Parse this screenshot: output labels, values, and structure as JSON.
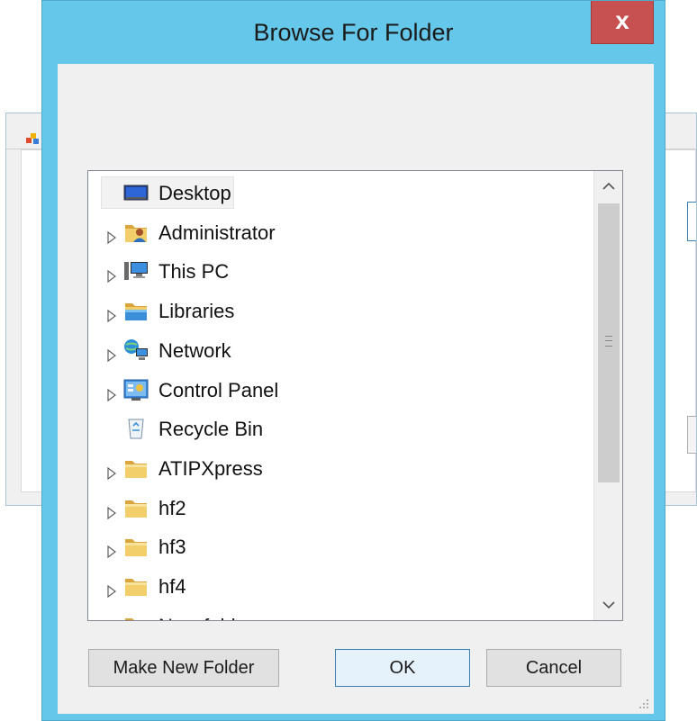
{
  "dialog": {
    "title": "Browse For Folder",
    "close_symbol": "x"
  },
  "tree": {
    "items": [
      {
        "label": "Desktop",
        "icon": "desktop-icon",
        "has_expander": false,
        "selected": true
      },
      {
        "label": "Administrator",
        "icon": "user-folder-icon",
        "has_expander": true
      },
      {
        "label": "This PC",
        "icon": "computer-icon",
        "has_expander": true
      },
      {
        "label": "Libraries",
        "icon": "libraries-icon",
        "has_expander": true
      },
      {
        "label": "Network",
        "icon": "network-icon",
        "has_expander": true
      },
      {
        "label": "Control Panel",
        "icon": "control-panel-icon",
        "has_expander": true
      },
      {
        "label": "Recycle Bin",
        "icon": "recycle-bin-icon",
        "has_expander": false
      },
      {
        "label": "ATIPXpress",
        "icon": "folder-icon",
        "has_expander": true
      },
      {
        "label": "hf2",
        "icon": "folder-icon",
        "has_expander": true
      },
      {
        "label": "hf3",
        "icon": "folder-icon",
        "has_expander": true
      },
      {
        "label": "hf4",
        "icon": "folder-icon",
        "has_expander": true
      },
      {
        "label": "New folder",
        "icon": "folder-icon",
        "has_expander": false
      }
    ]
  },
  "buttons": {
    "make_new_folder": "Make New Folder",
    "ok": "OK",
    "cancel": "Cancel"
  },
  "colors": {
    "title_bar": "#65c7e9",
    "close_button": "#c75050",
    "folder": "#e8c15a"
  }
}
